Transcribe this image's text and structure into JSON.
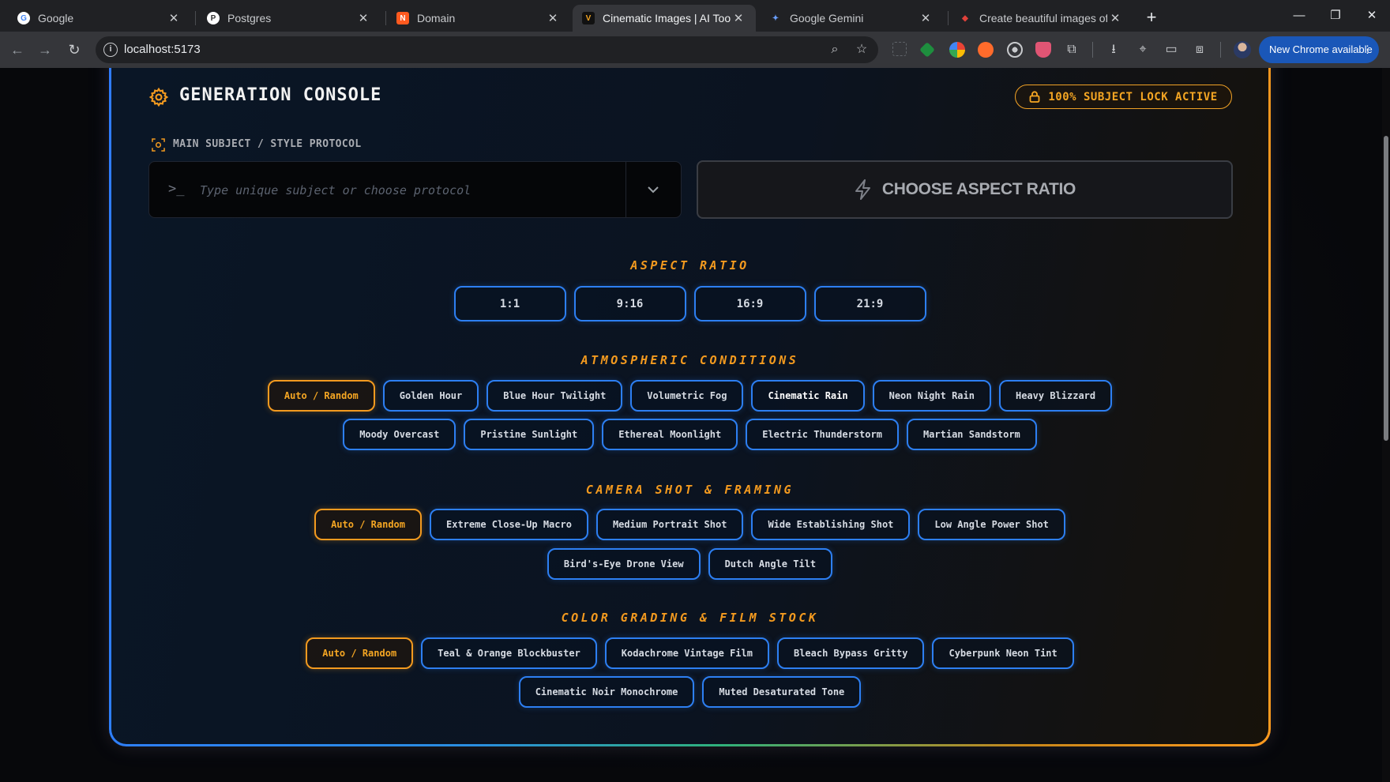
{
  "browser": {
    "tabs": [
      {
        "title": "Google",
        "favicon_color": "#ffffff",
        "favicon_text": "G"
      },
      {
        "title": "Postgres",
        "favicon_color": "#ffffff",
        "favicon_text": "P"
      },
      {
        "title": "Domain",
        "favicon_color": "#ff5a1f",
        "favicon_text": "N"
      },
      {
        "title": "Cinematic Images | AI Tools Pro",
        "favicon_color": "#222222",
        "favicon_text": "V"
      },
      {
        "title": "Google Gemini",
        "favicon_color": "#4c8bf5",
        "favicon_text": "✦"
      },
      {
        "title": "Create beautiful images of your",
        "favicon_color": "#e0413a",
        "favicon_text": "◆"
      }
    ],
    "active_tab_index": 3,
    "url": "localhost:5173",
    "update_button": "New Chrome available"
  },
  "console": {
    "title": "GENERATION CONSOLE",
    "lock_badge": "100% SUBJECT LOCK ACTIVE",
    "subject_section_label": "MAIN SUBJECT / STYLE PROTOCOL",
    "subject_prompt_symbol": ">_",
    "subject_input_value": "",
    "subject_input_placeholder": "Type unique subject or choose protocol",
    "aspect_button_label": "CHOOSE ASPECT RATIO"
  },
  "groups": {
    "aspect_ratio": {
      "title": "ASPECT RATIO",
      "options": [
        "1:1",
        "9:16",
        "16:9",
        "21:9"
      ]
    },
    "atmospheric": {
      "title": "ATMOSPHERIC CONDITIONS",
      "selected": "Auto / Random",
      "highlighted": "Cinematic Rain",
      "options": [
        "Auto / Random",
        "Golden Hour",
        "Blue Hour Twilight",
        "Volumetric Fog",
        "Cinematic Rain",
        "Neon Night Rain",
        "Heavy Blizzard",
        "Moody Overcast",
        "Pristine Sunlight",
        "Ethereal Moonlight",
        "Electric Thunderstorm",
        "Martian Sandstorm"
      ]
    },
    "camera": {
      "title": "CAMERA SHOT & FRAMING",
      "selected": "Auto / Random",
      "options": [
        "Auto / Random",
        "Extreme Close-Up Macro",
        "Medium Portrait Shot",
        "Wide Establishing Shot",
        "Low Angle Power Shot",
        "Bird's-Eye Drone View",
        "Dutch Angle Tilt"
      ]
    },
    "color_grading": {
      "title": "COLOR GRADING & FILM STOCK",
      "selected": "Auto / Random",
      "options": [
        "Auto / Random",
        "Teal & Orange Blockbuster",
        "Kodachrome Vintage Film",
        "Bleach Bypass Gritty",
        "Cyberpunk Neon Tint",
        "Cinematic Noir Monochrome",
        "Muted Desaturated Tone"
      ]
    }
  },
  "colors": {
    "accent_orange": "#f39a1f",
    "accent_blue": "#2d7ff2"
  }
}
